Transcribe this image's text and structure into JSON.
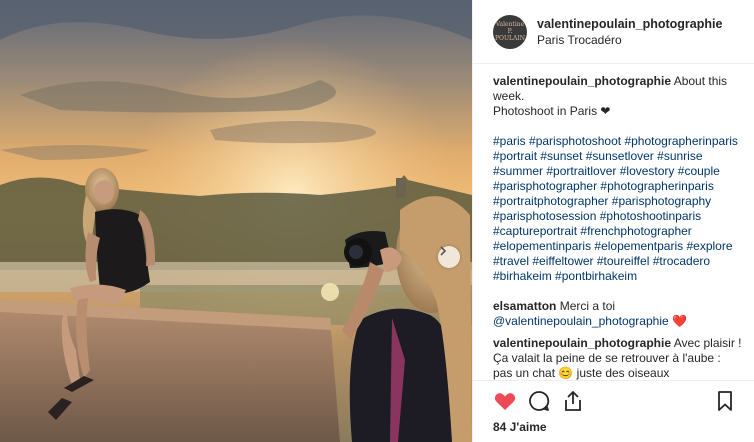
{
  "post": {
    "username": "valentinepoulain_photographie",
    "location": "Paris Trocadéro",
    "avatar_text": "Valentine P. POULAIN",
    "caption_line1": "About this week.",
    "caption_line2": "Photoshoot in Paris ❤",
    "hashtags": [
      "#paris",
      "#parisphotoshoot",
      "#photographerinparis",
      "#portrait",
      "#sunset",
      "#sunsetlover",
      "#sunrise",
      "#summer",
      "#portraitlover",
      "#lovestory",
      "#couple",
      "#parisphotographer",
      "#photographerinparis",
      "#portraitphotographer",
      "#parisphotography",
      "#parisphotosession",
      "#photoshootinparis",
      "#captureportrait",
      "#frenchphotographer",
      "#elopementinparis",
      "#elopementparis",
      "#explore",
      "#travel",
      "#eiffeltower",
      "#toureiffel",
      "#trocadero",
      "#birhakeim",
      "#pontbirhakeim"
    ]
  },
  "comments": [
    {
      "user": "elsamatton",
      "text": "Merci a toi",
      "mention": "@valentinepoulain_photographie",
      "emoji": "❤️"
    },
    {
      "user": "valentinepoulain_photographie",
      "text": "Avec plaisir ! Ça valait la peine de se retrouver à l'aube : pas un chat 😊 juste des oiseaux"
    }
  ],
  "stats": {
    "likes": "84 J'aime"
  },
  "icons": [
    "heart-filled-icon",
    "comment-icon",
    "share-icon",
    "bookmark-icon",
    "chevron-right-icon"
  ],
  "colors": {
    "like": "#ed4956",
    "hashtag": "#003569",
    "border": "#efefef"
  }
}
